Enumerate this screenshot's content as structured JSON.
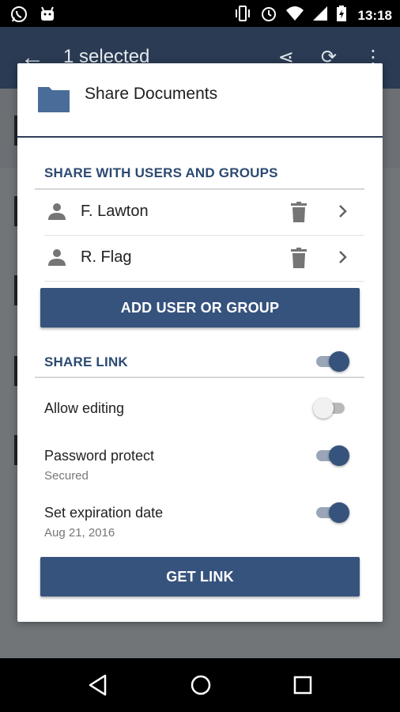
{
  "status_bar": {
    "time": "13:18",
    "left_icons": [
      "whatsapp-icon",
      "android-icon"
    ],
    "right_icons": [
      "vibrate-icon",
      "alarm-icon",
      "wifi-icon",
      "signal-icon",
      "battery-charging-icon"
    ]
  },
  "app_bar": {
    "title": "1 selected",
    "actions": [
      "share-icon",
      "sync-icon",
      "more-vert-icon"
    ]
  },
  "dialog": {
    "title": "Share Documents",
    "users_section": {
      "title": "SHARE WITH USERS AND GROUPS",
      "users": [
        {
          "name": "F. Lawton"
        },
        {
          "name": "R. Flag"
        }
      ],
      "add_button": "ADD USER OR GROUP"
    },
    "link_section": {
      "title": "SHARE LINK",
      "enabled": true,
      "options": [
        {
          "label": "Allow editing",
          "sub": "",
          "enabled": false
        },
        {
          "label": "Password protect",
          "sub": "Secured",
          "enabled": true
        },
        {
          "label": "Set expiration date",
          "sub": "Aug 21, 2016",
          "enabled": true
        }
      ],
      "get_link_button": "GET LINK"
    }
  },
  "colors": {
    "accent": "#36537d",
    "section_title": "#2c4a72",
    "app_bar": "#2a3b53"
  },
  "nav_bar": [
    "back-icon",
    "home-icon",
    "recents-icon"
  ]
}
